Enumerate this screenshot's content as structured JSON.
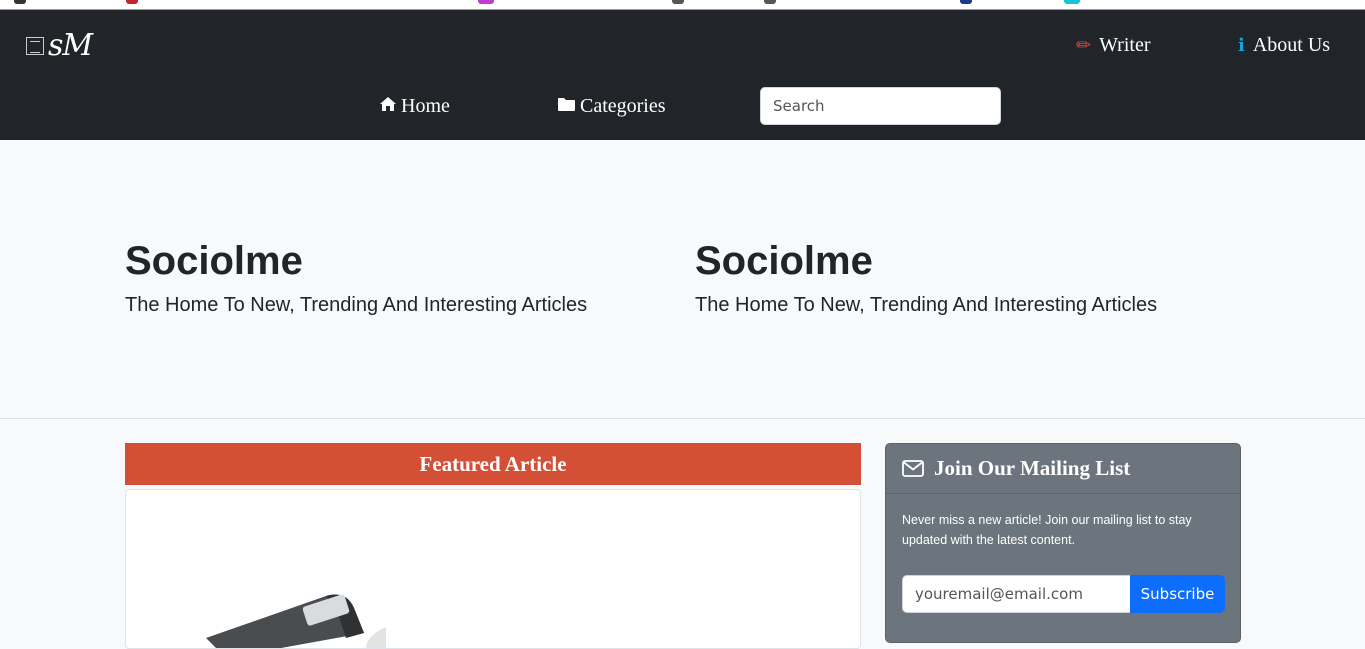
{
  "brand": {
    "logo_text": "sM"
  },
  "nav": {
    "writer_label": "Writer",
    "about_label": "About Us",
    "home_label": "Home",
    "categories_label": "Categories",
    "search_placeholder": "Search"
  },
  "hero": [
    {
      "title": "Sociolme",
      "tagline": "The Home To New, Trending And Interesting Articles"
    },
    {
      "title": "Sociolme",
      "tagline": "The Home To New, Trending And Interesting Articles"
    }
  ],
  "featured": {
    "header": "Featured Article"
  },
  "mailing": {
    "title": "Join Our Mailing List",
    "description": "Never miss a new article! Join our mailing list to stay updated with the latest content.",
    "email_placeholder": "youremail@email.com",
    "subscribe_label": "Subscribe"
  },
  "colors": {
    "navbar": "#212529",
    "featured_header": "#d34f35",
    "mailing_card": "#6c757d",
    "subscribe_button": "#0d6efd",
    "writer_icon": "#dc4b3a",
    "about_icon": "#17a2d8"
  },
  "icons": {
    "writer": "pencil-icon",
    "about": "info-icon",
    "home": "home-icon",
    "categories": "folder-icon",
    "mailing": "envelope-icon"
  }
}
